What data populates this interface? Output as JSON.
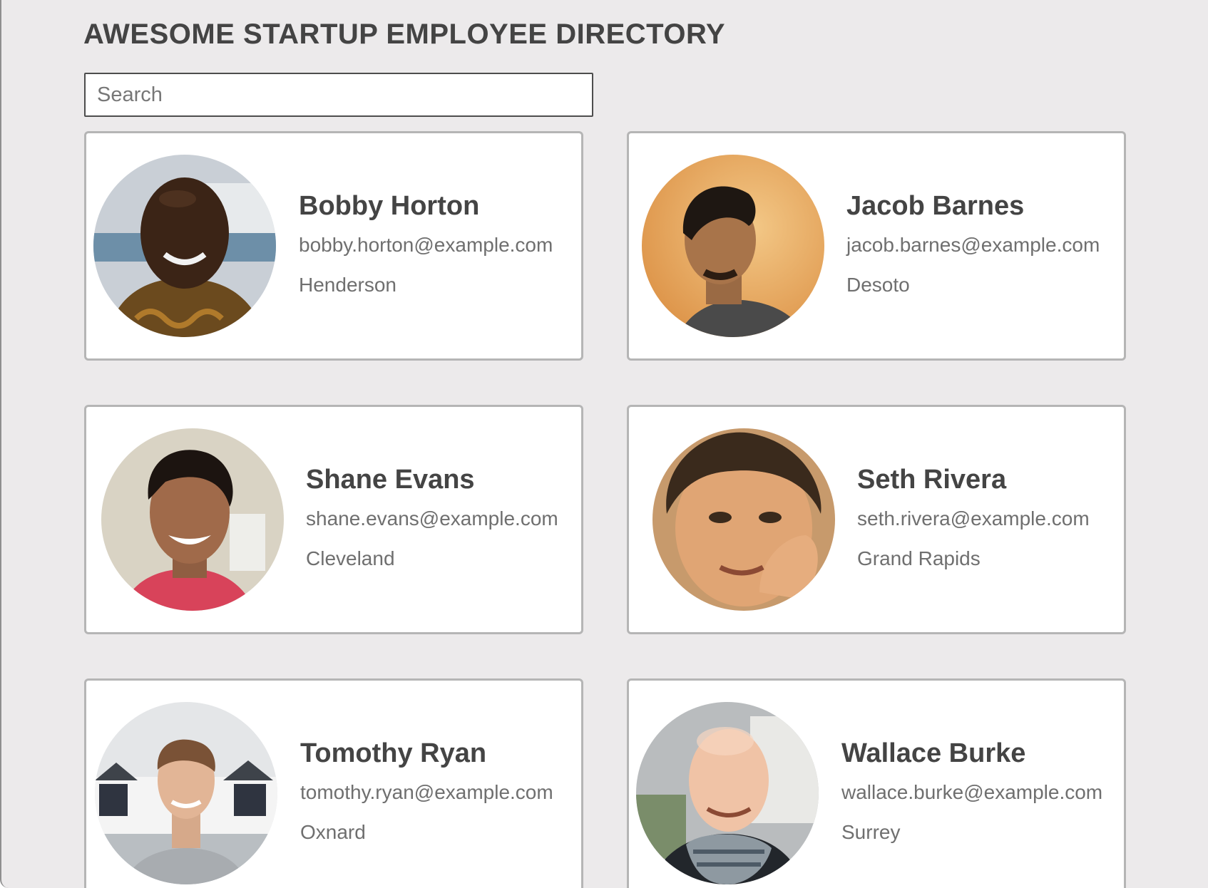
{
  "header": {
    "title": "AWESOME STARTUP EMPLOYEE DIRECTORY"
  },
  "search": {
    "placeholder": "Search"
  },
  "employees": [
    {
      "name": "Bobby Horton",
      "email": "bobby.horton@example.com",
      "city": "Henderson"
    },
    {
      "name": "Jacob Barnes",
      "email": "jacob.barnes@example.com",
      "city": "Desoto"
    },
    {
      "name": "Shane Evans",
      "email": "shane.evans@example.com",
      "city": "Cleveland"
    },
    {
      "name": "Seth Rivera",
      "email": "seth.rivera@example.com",
      "city": "Grand Rapids"
    },
    {
      "name": "Tomothy Ryan",
      "email": "tomothy.ryan@example.com",
      "city": "Oxnard"
    },
    {
      "name": "Wallace Burke",
      "email": "wallace.burke@example.com",
      "city": "Surrey"
    }
  ]
}
